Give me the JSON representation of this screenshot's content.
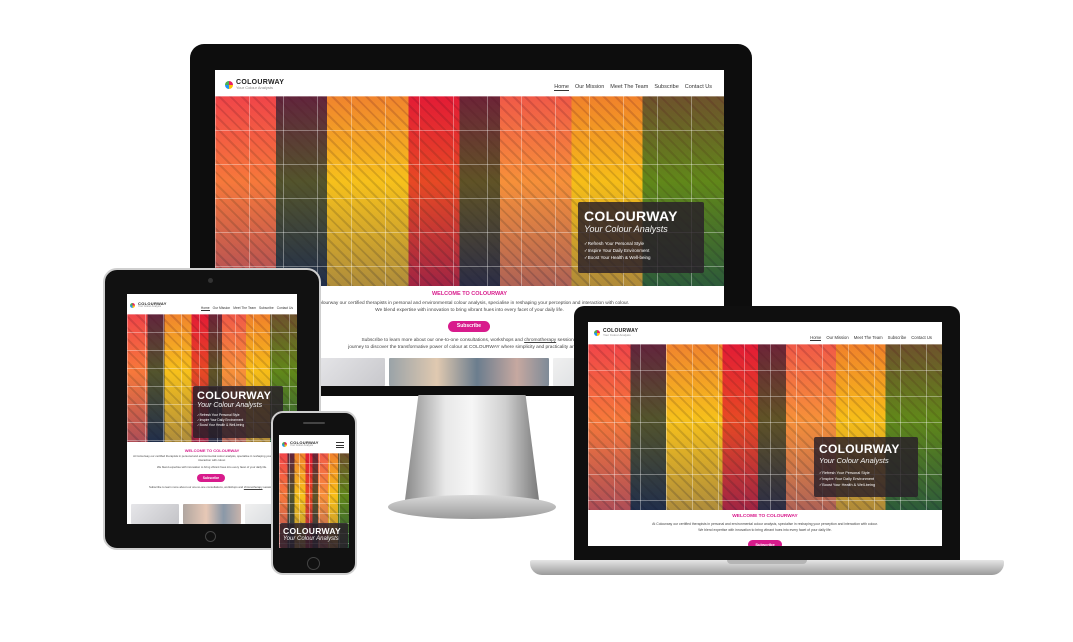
{
  "brand": {
    "name": "COLOURWAY",
    "tagline": "Your Colour Analysts"
  },
  "nav": [
    "Home",
    "Our Mission",
    "Meet The Team",
    "Subscribe",
    "Contact Us"
  ],
  "hero": {
    "title": "COLOURWAY",
    "subtitle": "Your Colour Analysts",
    "bullets": [
      "Refresh Your Personal Style",
      "Inspire Your Daily Environment",
      "Boost Your Health & Well-being"
    ]
  },
  "welcome": {
    "heading": "WELCOME TO COLOURWAY",
    "para1": "At Colourway our certified therapists in personal and environmental colour analysis, specialise in reshaping your perception and interaction with colour.",
    "para2": "We blend expertise with innovation to bring vibrant hues into every facet of your daily life.",
    "subscribe_label": "Subscribe",
    "para3": "Subscribe to learn more about our one-to-one consultations, workshops and",
    "para3_link": "chromotherapy",
    "para3_end": "sessions.",
    "para4": "journey to discover the transformative power of colour at COLOURWAY where simplicity and practicality are the co"
  },
  "colors": {
    "accent": "#d81b8c",
    "frame": "#111111",
    "silver": "#c9c9c9"
  }
}
